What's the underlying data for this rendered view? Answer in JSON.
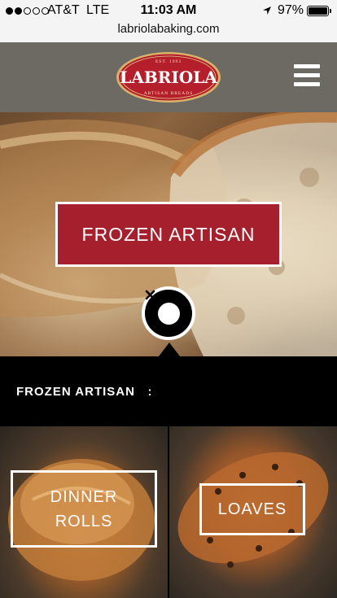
{
  "status_bar": {
    "carrier": "AT&T",
    "network": "LTE",
    "time": "11:03 AM",
    "battery": "97%",
    "battery_level": 0.97,
    "signal_bars": 2
  },
  "address_bar": {
    "url": "labriolabaking.com"
  },
  "header": {
    "logo": {
      "est": "EST. 1993",
      "name": "LABRIOLA",
      "tagline": "ARTISAN BREADS"
    },
    "menu_icon": "hamburger-icon"
  },
  "hero": {
    "label": "FROZEN ARTISAN",
    "close_icon": "close-icon"
  },
  "panel": {
    "title": "FROZEN ARTISAN   :",
    "tiles": [
      {
        "label": "DINNER ROLLS"
      },
      {
        "label": "LOAVES"
      }
    ]
  },
  "colors": {
    "brand_red": "#a5202c",
    "header_gray": "#6c6a63"
  }
}
